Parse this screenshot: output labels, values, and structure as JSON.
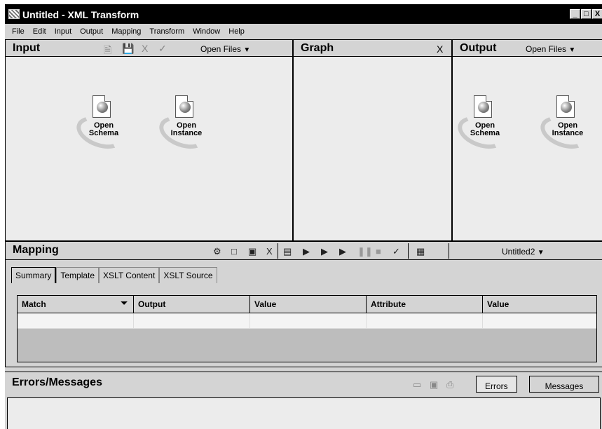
{
  "window": {
    "title": "Untitled - XML Transform",
    "controls": {
      "minimize": "_",
      "maximize": "□",
      "close": "X"
    }
  },
  "menu": [
    "File",
    "Edit",
    "Input",
    "Output",
    "Mapping",
    "Transform",
    "Window",
    "Help"
  ],
  "input_pane": {
    "title": "Input",
    "cancel": "X",
    "check": "✓",
    "open_files": "Open Files",
    "widgets": [
      {
        "line1": "Open",
        "line2": "Schema"
      },
      {
        "line1": "Open",
        "line2": "Instance"
      }
    ]
  },
  "graph_pane": {
    "title": "Graph",
    "close": "X"
  },
  "output_pane": {
    "title": "Output",
    "open_files": "Open Files",
    "widgets": [
      {
        "line1": "Open",
        "line2": "Schema"
      },
      {
        "line1": "Open",
        "line2": "Instance"
      }
    ]
  },
  "mapping_pane": {
    "title": "Mapping",
    "delete": "X",
    "dropdown": "Untitled2",
    "tabs": [
      "Summary",
      "Template",
      "XSLT Content",
      "XSLT Source"
    ],
    "columns": [
      "Match",
      "Output",
      "Value",
      "Attribute",
      "Value"
    ]
  },
  "errors_pane": {
    "title": "Errors/Messages",
    "tabs": [
      "Errors",
      "Messages"
    ]
  },
  "colors": {
    "chrome": "#d4d4d4",
    "titlebar": "#000000",
    "body": "#ececec"
  }
}
